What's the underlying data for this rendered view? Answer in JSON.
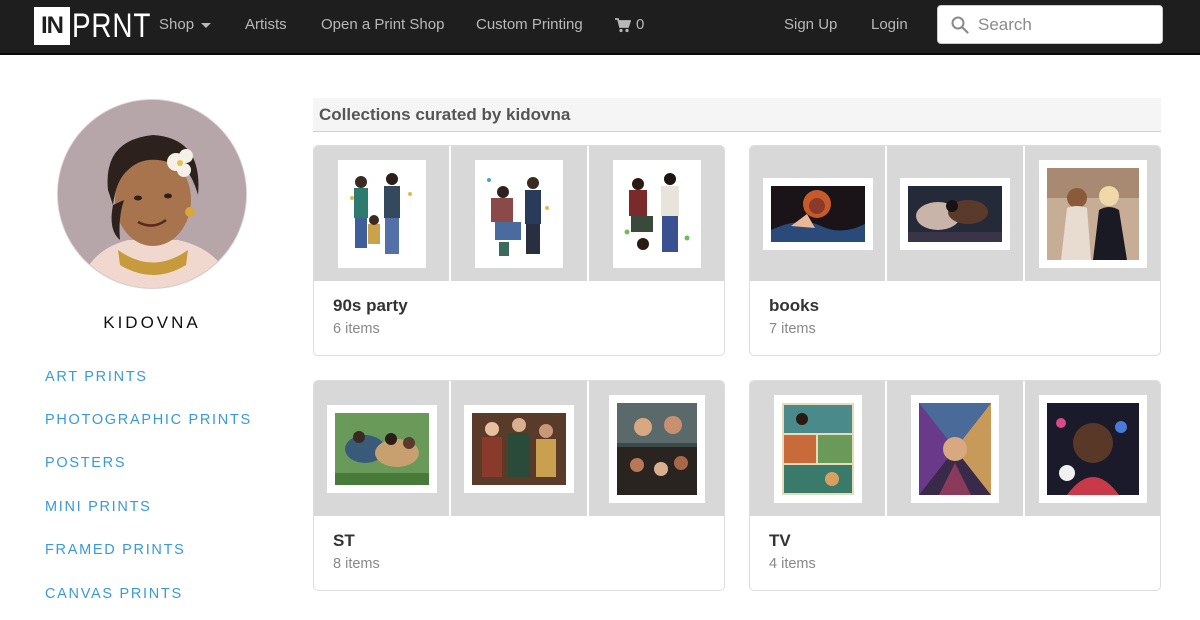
{
  "brand": {
    "logo_box": "IN",
    "logo_rest": "PRNT"
  },
  "nav": {
    "shop": "Shop",
    "artists": "Artists",
    "open_shop": "Open a Print Shop",
    "custom": "Custom Printing",
    "cart_count": "0",
    "sign_up": "Sign Up",
    "login": "Login"
  },
  "search": {
    "placeholder": "Search",
    "value": ""
  },
  "artist": {
    "name": "KIDOVNA"
  },
  "sidebar": {
    "items": [
      {
        "label": "ART PRINTS"
      },
      {
        "label": "PHOTOGRAPHIC PRINTS"
      },
      {
        "label": "POSTERS"
      },
      {
        "label": "MINI PRINTS"
      },
      {
        "label": "FRAMED PRINTS"
      },
      {
        "label": "CANVAS PRINTS"
      }
    ]
  },
  "main": {
    "heading": "Collections curated by kidovna"
  },
  "collections": [
    {
      "title": "90s party",
      "count": "6 items"
    },
    {
      "title": "books",
      "count": "7 items"
    },
    {
      "title": "ST",
      "count": "8 items"
    },
    {
      "title": "TV",
      "count": "4 items"
    }
  ],
  "colors": {
    "nav_bg": "#1e1e1e",
    "link_accent": "#3a9ad4",
    "thumb_bg": "#d8d8d8"
  }
}
